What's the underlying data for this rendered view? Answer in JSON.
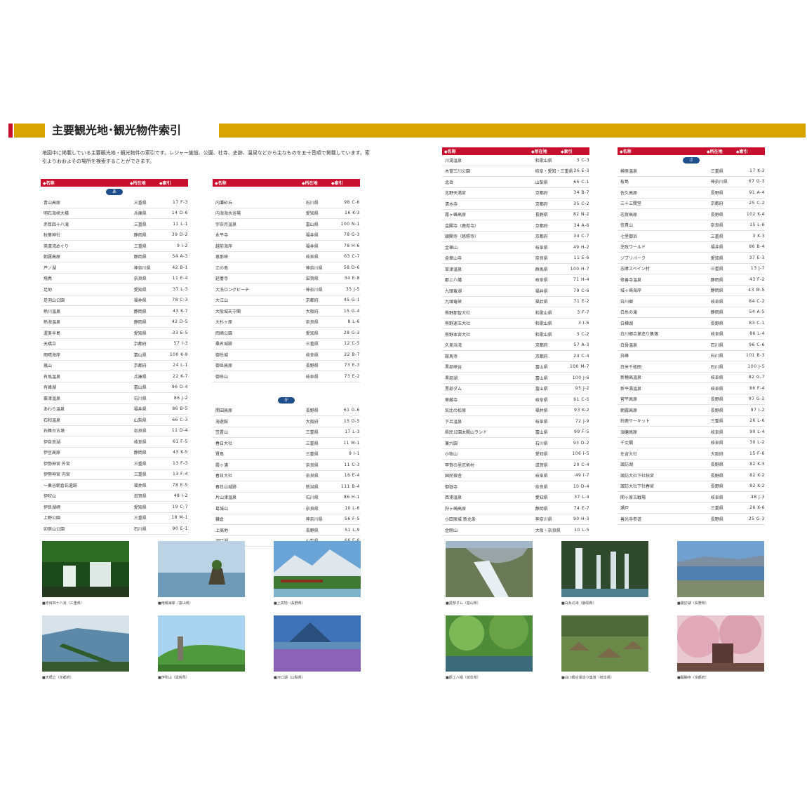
{
  "header": {
    "title": "主要観光地･観光物件索引"
  },
  "intro": "地図中に掲載している主要観光地・観光物件の索引です。レジャー施設、公園、社寺、史跡、温泉などから主なものを五十音順で掲載しています。索引よりおおよその場所を検索することができます。",
  "columns_header": {
    "name": "◆名称",
    "pref": "◆所在地",
    "idx": "◆索引"
  },
  "col1": {
    "section": "あ",
    "rows": [
      [
        "青山高原",
        "三重県",
        "17 F-3"
      ],
      [
        "明石海峡大橋",
        "兵庫県",
        "14 D-6"
      ],
      [
        "赤目四十八滝",
        "三重県",
        "11 L-1"
      ],
      [
        "秋葉神社",
        "静岡県",
        "39 D-2"
      ],
      [
        "英虞湾めぐり",
        "三重県",
        "9 I-2"
      ],
      [
        "朝霧高原",
        "静岡県",
        "54 A-3"
      ],
      [
        "芦ノ湖",
        "神奈川県",
        "42 B-1"
      ],
      [
        "飛鳥",
        "奈良県",
        "11 E-4"
      ],
      [
        "足助",
        "愛知県",
        "37 L-3"
      ],
      [
        "足羽山公園",
        "福井県",
        "78 C-3"
      ],
      [
        "熱川温泉",
        "静岡県",
        "43 K-7"
      ],
      [
        "熱海温泉",
        "静岡県",
        "42 D-5"
      ],
      [
        "渥美半島",
        "愛知県",
        "33 E-5"
      ],
      [
        "天橋立",
        "京都府",
        "57 I-3"
      ],
      [
        "雨晴海岸",
        "富山県",
        "100 K-9"
      ],
      [
        "嵐山",
        "京都府",
        "24 L-1"
      ],
      [
        "有馬温泉",
        "兵庫県",
        "22 K-7"
      ],
      [
        "有峰湖",
        "富山県",
        "96 D-4"
      ],
      [
        "粟津温泉",
        "石川県",
        "86 J-2"
      ],
      [
        "あわら温泉",
        "福井県",
        "86 B-5"
      ],
      [
        "石和温泉",
        "山梨県",
        "66 C-3"
      ],
      [
        "石舞台古墳",
        "奈良県",
        "11 D-4"
      ],
      [
        "伊自良湖",
        "岐阜県",
        "61 F-5"
      ],
      [
        "伊豆高原",
        "静岡県",
        "43 K-5"
      ],
      [
        "伊勢神宮 外宮",
        "三重県",
        "13 F-3"
      ],
      [
        "伊勢神宮 内宮",
        "三重県",
        "13 F-4"
      ],
      [
        "一乗谷朝倉氏遺跡",
        "福井県",
        "78 E-5"
      ],
      [
        "伊吹山",
        "滋賀県",
        "48 I-2"
      ],
      [
        "伊良湖岬",
        "愛知県",
        "19 C-7"
      ],
      [
        "上野公園",
        "三重県",
        "18 M-1"
      ],
      [
        "卯辰山公園",
        "石川県",
        "90 E-1"
      ]
    ]
  },
  "col2": {
    "rows_top": [
      [
        "内灘砂丘",
        "石川県",
        "98 C-6"
      ],
      [
        "内海海水浴場",
        "愛知県",
        "16 K-3"
      ],
      [
        "宇奈月温泉",
        "富山県",
        "100 N-1"
      ],
      [
        "永平寺",
        "福井県",
        "78 G-3"
      ],
      [
        "越前海岸",
        "福井県",
        "78 H-6"
      ],
      [
        "恵那峡",
        "岐阜県",
        "63 C-7"
      ],
      [
        "江の島",
        "神奈川県",
        "58 D-6"
      ],
      [
        "延暦寺",
        "滋賀県",
        "34 E-8"
      ],
      [
        "大洗ロングビーチ",
        "神奈川県",
        "35 J-5"
      ],
      [
        "大江山",
        "京都府",
        "45 G-1"
      ],
      [
        "大阪城天守閣",
        "大阪府",
        "15 G-4"
      ],
      [
        "大杉ヶ原",
        "奈良県",
        "8 L-6"
      ],
      [
        "岡崎公園",
        "愛知県",
        "28 G-3"
      ],
      [
        "桑名城跡",
        "三重県",
        "12 C-5"
      ],
      [
        "御岳城",
        "岐阜県",
        "22 B-7"
      ],
      [
        "御岳高原",
        "長野県",
        "73 E-3"
      ],
      [
        "御岳山",
        "岐阜県",
        "73 E-2"
      ]
    ],
    "section": "か",
    "rows_bottom": [
      [
        "開田高原",
        "長野県",
        "61 G-6"
      ],
      [
        "海遊館",
        "大阪府",
        "15 D-5"
      ],
      [
        "笠置山",
        "三重県",
        "17 L-3"
      ],
      [
        "春日大社",
        "三重県",
        "11 M-1"
      ],
      [
        "賢島",
        "三重県",
        "9 I-1"
      ],
      [
        "霞ヶ浦",
        "奈良県",
        "11 C-3"
      ],
      [
        "春日大社",
        "奈良県",
        "16 E-4"
      ],
      [
        "春日山城跡",
        "新潟県",
        "111 B-4"
      ],
      [
        "片山津温泉",
        "石川県",
        "86 H-1"
      ],
      [
        "葛城山",
        "奈良県",
        "10 L-6"
      ],
      [
        "鎌倉",
        "神奈川県",
        "56 F-5"
      ],
      [
        "上高地",
        "長野県",
        "51 L-9"
      ],
      [
        "河口湖",
        "山梨県",
        "66 F-6"
      ]
    ]
  },
  "col3": {
    "rows": [
      [
        "川湯温泉",
        "和歌山県",
        "3 C-3"
      ],
      [
        "木曽三川公園",
        "岐阜・愛知・三重県",
        "26 E-3"
      ],
      [
        "北岳",
        "山梨県",
        "65 C-1"
      ],
      [
        "北野天満宮",
        "京都府",
        "34 B-7"
      ],
      [
        "清水寺",
        "京都府",
        "35 C-2"
      ],
      [
        "霧ヶ峰高原",
        "長野県",
        "82 N-2"
      ],
      [
        "金閣寺（鹿苑寺）",
        "京都府",
        "34 A-6"
      ],
      [
        "銀閣寺（慈照寺）",
        "京都府",
        "34 C-7"
      ],
      [
        "金華山",
        "岐阜県",
        "49 H-2"
      ],
      [
        "金華山寺",
        "奈良県",
        "11 E-6"
      ],
      [
        "草津温泉",
        "群馬県",
        "100 H-7"
      ],
      [
        "郡上八幡",
        "岐阜県",
        "71 H-4"
      ],
      [
        "九頭竜湖",
        "福井県",
        "79 C-6"
      ],
      [
        "九頭竜峡",
        "福井県",
        "71 E-2"
      ],
      [
        "熊野那智大社",
        "和歌山県",
        "3 F-7"
      ],
      [
        "熊野速玉大社",
        "和歌山県",
        "3 I-6"
      ],
      [
        "熊野本宮大社",
        "和歌山県",
        "3 C-2"
      ],
      [
        "久美浜湾",
        "京都府",
        "57 A-3"
      ],
      [
        "鞍馬寺",
        "京都府",
        "24 C-4"
      ],
      [
        "黒部峡谷",
        "富山県",
        "100 M-7"
      ],
      [
        "黒部湖",
        "富山県",
        "100 J-6"
      ],
      [
        "黒部ダム",
        "富山県",
        "95 J-2"
      ],
      [
        "華厳寺",
        "岐阜県",
        "61 C-5"
      ],
      [
        "気比の松原",
        "福井県",
        "93 K-2"
      ],
      [
        "下呂温泉",
        "岐阜県",
        "72 J-9"
      ],
      [
        "県民公園太閤山ランド",
        "富山県",
        "99 F-5"
      ],
      [
        "兼六園",
        "石川県",
        "93 D-2"
      ],
      [
        "小牧山",
        "愛知県",
        "106 I-5"
      ],
      [
        "甲賀の里忍術村",
        "滋賀県",
        "20 C-4"
      ],
      [
        "国民宿舎",
        "岐阜県",
        "49 I-7"
      ],
      [
        "御嶽寺",
        "奈良県",
        "10 D-4"
      ],
      [
        "西浦温泉",
        "愛知県",
        "37 L-4"
      ],
      [
        "狩ヶ崎高原",
        "静岡県",
        "74 E-7"
      ],
      [
        "小田原城 新北条",
        "神奈川県",
        "90 H-3"
      ],
      [
        "金剛山",
        "大阪・奈良県",
        "10 L-5"
      ]
    ]
  },
  "col4": {
    "section": "さ",
    "rows": [
      [
        "榊原温泉",
        "三重県",
        "17 K-3"
      ],
      [
        "桜島",
        "神奈川県",
        "67 G-3"
      ],
      [
        "佐久高原",
        "長野県",
        "91 A-4"
      ],
      [
        "三十三間堂",
        "京都府",
        "25 C-2"
      ],
      [
        "志賀高原",
        "長野県",
        "102 K-4"
      ],
      [
        "信貴山",
        "奈良県",
        "15 L-6"
      ],
      [
        "七里御浜",
        "三重県",
        "3 K-3"
      ],
      [
        "芝政ワールド",
        "福井県",
        "86 B-4"
      ],
      [
        "ジブリパーク",
        "愛知県",
        "37 E-3"
      ],
      [
        "志摩スペイン村",
        "三重県",
        "13 J-7"
      ],
      [
        "修善寺温泉",
        "静岡県",
        "43 F-2"
      ],
      [
        "城ヶ崎海岸",
        "静岡県",
        "43 M-5"
      ],
      [
        "白川郷",
        "岐阜県",
        "84 C-2"
      ],
      [
        "白糸の滝",
        "静岡県",
        "54 A-5"
      ],
      [
        "白樺湖",
        "長野県",
        "83 C-1"
      ],
      [
        "白川郷合掌造り集落",
        "岐阜県",
        "86 L-4"
      ],
      [
        "白骨温泉",
        "石川県",
        "96 C-6"
      ],
      [
        "白峰",
        "石川県",
        "101 B-3"
      ],
      [
        "白米千枚田",
        "石川県",
        "100 J-5"
      ],
      [
        "新穂高温泉",
        "岐阜県",
        "82 G-7"
      ],
      [
        "新平湯温泉",
        "岐阜県",
        "86 F-4"
      ],
      [
        "菅平高原",
        "長野県",
        "97 G-2"
      ],
      [
        "朝霧高原",
        "長野県",
        "97 I-2"
      ],
      [
        "鈴鹿サーキット",
        "三重県",
        "26 L-6"
      ],
      [
        "須磨高原",
        "岐阜県",
        "90 L-4"
      ],
      [
        "千丈閣",
        "岐阜県",
        "30 L-2"
      ],
      [
        "住吉大社",
        "大阪府",
        "15 F-6"
      ],
      [
        "諏訪湖",
        "長野県",
        "82 K-3"
      ],
      [
        "諏訪大社下社秋宮",
        "長野県",
        "82 K-2"
      ],
      [
        "諏訪大社下社春宮",
        "長野県",
        "82 K-2"
      ],
      [
        "関ヶ原古戦場",
        "岐阜県",
        "48 J-3"
      ],
      [
        "瀬戸",
        "三重県",
        "26 K-6"
      ],
      [
        "善光寺参道",
        "長野県",
        "25 G-3"
      ]
    ]
  },
  "photos": {
    "left": [
      "■赤目四十八滝（三重県）",
      "■雨晴海岸（富山県）",
      "■上高地（長野県）",
      "■天橋立（京都府）",
      "■伊吹山（滋賀県）",
      "■河口湖（山梨県）"
    ],
    "right": [
      "■黒部ダム（富山県）",
      "■白糸の滝（静岡県）",
      "■諏訪湖（長野県）",
      "■郡上八幡（岐阜県）",
      "■白川郷合掌造り集落（岐阜県）",
      "■醍醐寺（京都府）"
    ]
  },
  "colors": {
    "accent_red": "#c8102e",
    "accent_gold": "#d9a400",
    "section_blue": "#1f4e8c"
  }
}
